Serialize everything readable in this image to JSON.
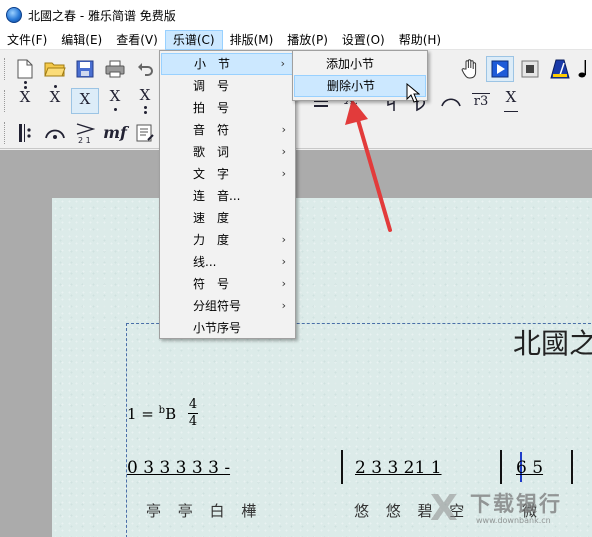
{
  "window": {
    "title": "北國之春 - 雅乐简谱 免费版"
  },
  "menubar": {
    "items": [
      "文件(F)",
      "编辑(E)",
      "查看(V)",
      "乐谱(C)",
      "排版(M)",
      "播放(P)",
      "设置(O)",
      "帮助(H)"
    ],
    "active_index": 3
  },
  "score_menu": {
    "items": [
      {
        "label": "小　节",
        "submenu": true
      },
      {
        "label": "调　号",
        "submenu": false
      },
      {
        "label": "拍　号",
        "submenu": false
      },
      {
        "label": "音　符",
        "submenu": true
      },
      {
        "label": "歌　词",
        "submenu": true
      },
      {
        "label": "文　字",
        "submenu": true
      },
      {
        "label": "连　音...",
        "submenu": false
      },
      {
        "label": "速　度",
        "submenu": false
      },
      {
        "label": "力　度",
        "submenu": true
      },
      {
        "label": "线...",
        "submenu": true
      },
      {
        "label": "符　号",
        "submenu": true
      },
      {
        "label": "分组符号",
        "submenu": true
      },
      {
        "label": "小节序号",
        "submenu": false
      }
    ],
    "highlighted_index": 0
  },
  "measure_submenu": {
    "items": [
      "添加小节",
      "删除小节"
    ],
    "highlighted_index": 1
  },
  "toolbar": {
    "row1_icons": [
      "new-file-icon",
      "open-folder-icon",
      "save-icon",
      "print-icon",
      "undo-icon",
      "hand-icon",
      "play-icon",
      "stop-icon",
      "metronome-icon",
      "note-icon"
    ],
    "row2_icons": [
      "note-x-icon",
      "note-x-dot-above-icon",
      "note-x-pressed-icon",
      "note-x-dots-icon",
      "note-x-dots-below-icon",
      "align-icon",
      "note-x-dotted-icon",
      "natural-icon",
      "flat-icon",
      "slur-icon",
      "triplet-icon",
      "note-x-beam-icon"
    ],
    "row3_icons": [
      "repeat-start-icon",
      "fermata-icon",
      "crescendo-icon",
      "mf-dynamic-icon",
      "score-text-icon"
    ],
    "dynamic_label": "mf",
    "triplet_label": "r3"
  },
  "score": {
    "title": "北國之",
    "key_prefix": "1 =",
    "key_flat": "b",
    "key_note": "B",
    "time_top": "4",
    "time_bottom": "4",
    "measure1": "0 3   3 3 3   3     -",
    "measure2": "2 3   3 21 1",
    "measure3": "6 5",
    "lyrics1": "亭 亭 白 樺",
    "lyrics2": "悠 悠 碧 空",
    "lyrics3": "微"
  },
  "watermark": {
    "text": "下载银行",
    "url_text": "www.downbank.cn",
    "mark": "X"
  },
  "colors": {
    "menu_highlight": "#cce8ff",
    "paper": "#dcebe9",
    "workspace": "#ababab",
    "arrow": "#e23b3b"
  }
}
